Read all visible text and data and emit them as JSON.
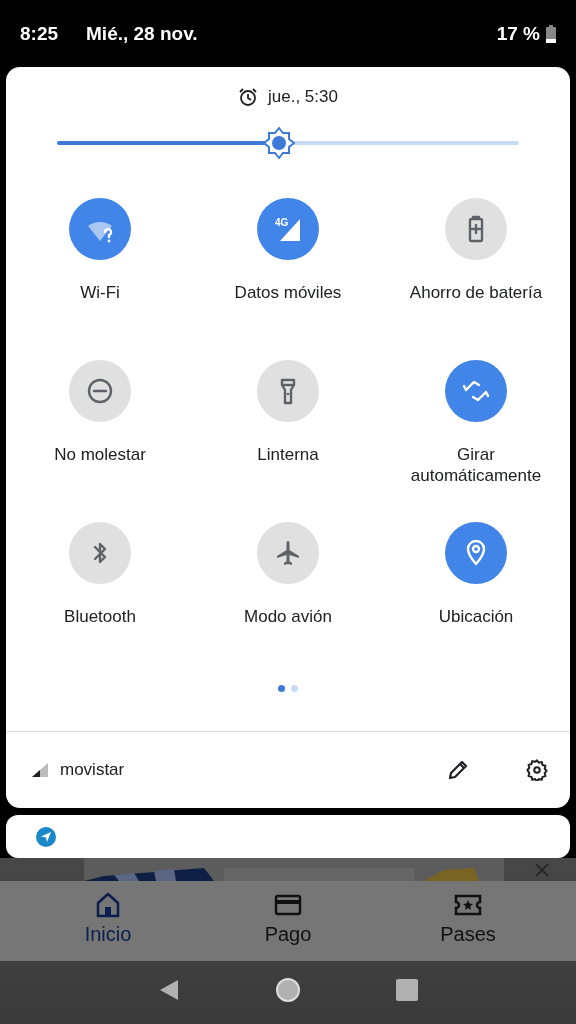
{
  "status_bar": {
    "time": "8:25",
    "date": "Mié., 28 nov.",
    "battery": "17 %"
  },
  "quick_settings": {
    "alarm": "jue., 5:30",
    "brightness": {
      "level": 0.48
    },
    "mobile_data_badge": "4G",
    "tiles": [
      {
        "label": "Wi-Fi",
        "on": true
      },
      {
        "label": "Datos móviles",
        "on": true
      },
      {
        "label": "Ahorro de batería",
        "on": false
      },
      {
        "label": "No molestar",
        "on": false
      },
      {
        "label": "Linterna",
        "on": false
      },
      {
        "label": "Girar automáticamente",
        "on": true
      },
      {
        "label": "Bluetooth",
        "on": false
      },
      {
        "label": "Modo avión",
        "on": false
      },
      {
        "label": "Ubicación",
        "on": true
      }
    ],
    "pages": [
      {
        "selected": true
      },
      {
        "selected": false
      }
    ],
    "carrier": "movistar"
  },
  "notification": {
    "kind": "app"
  },
  "app_nav": [
    {
      "label": "Inicio",
      "selected": true
    },
    {
      "label": "Pago",
      "selected": false
    },
    {
      "label": "Pases",
      "selected": false
    }
  ]
}
